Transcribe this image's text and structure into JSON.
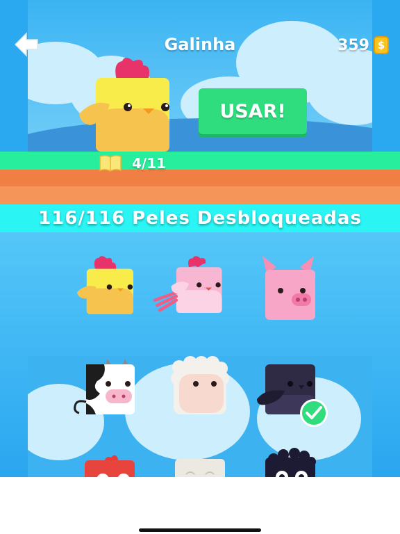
{
  "header": {
    "title": "Galinha",
    "coins": "359",
    "coin_symbol": "$",
    "use_label": "USAR!"
  },
  "progress": {
    "value": "4/11"
  },
  "banner": {
    "text": "116/116 Peles Desbloqueadas"
  },
  "skins": [
    {
      "name": "chicken",
      "selected": false
    },
    {
      "name": "pink-bird",
      "selected": false
    },
    {
      "name": "pig",
      "selected": false
    },
    {
      "name": "cow",
      "selected": false
    },
    {
      "name": "sheep",
      "selected": false
    },
    {
      "name": "crow",
      "selected": true
    },
    {
      "name": "red-bird",
      "selected": false
    },
    {
      "name": "white-animal",
      "selected": false
    },
    {
      "name": "penguin",
      "selected": false
    }
  ],
  "colors": {
    "use_button": "#2fdc7e",
    "banner": "#2af4f4",
    "stripe_green": "#27ee9c",
    "stripe_orange": "#ef7f45",
    "sky": "#2aa8f0"
  }
}
